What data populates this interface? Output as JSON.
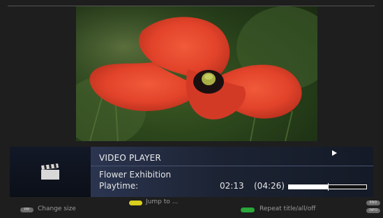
{
  "player": {
    "title": "VIDEO PLAYER",
    "file_name": "Flower Exhibition",
    "playtime_label": "Playtime:",
    "time_current": "02:13",
    "time_total": "(04:26)",
    "progress_fraction": 0.5,
    "state": "playing"
  },
  "hints": {
    "pip_key": "PIP",
    "change_size": "Change size",
    "jump_to": "Jump to ...",
    "repeat": "Repeat title/all/off",
    "end_key": "END",
    "info_key": "INFO"
  },
  "colors": {
    "yellow_key": "#d8cf1e",
    "green_key": "#2aa63a",
    "panel_accent": "#2b3550"
  },
  "icons": {
    "file_type": "clapperboard-icon",
    "status": "play-icon"
  }
}
